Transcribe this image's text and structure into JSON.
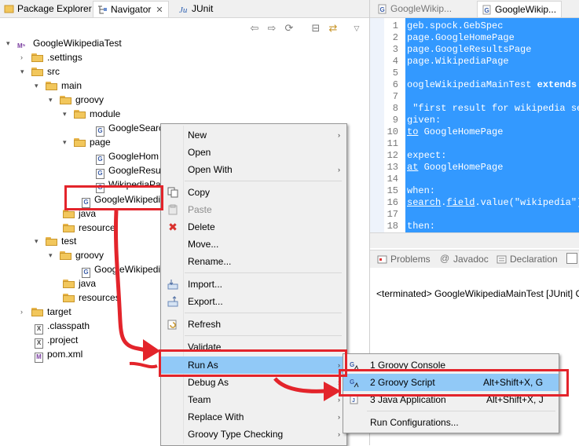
{
  "left_tabs": {
    "package_explorer": "Package Explorer",
    "navigator": "Navigator",
    "navigator_close": "✕",
    "junit": "JUnit"
  },
  "tree": {
    "project": "GoogleWikipediaTest",
    "settings": ".settings",
    "src": "src",
    "main": "main",
    "groovy": "groovy",
    "module": "module",
    "module_file": "GoogleSearc",
    "page": "page",
    "page_file_1": "GoogleHom",
    "page_file_2": "GoogleResu",
    "page_file_3": "WikipediaPa",
    "selected_file": "GoogleWikipedi",
    "java": "java",
    "resources": "resource",
    "test": "test",
    "test_groovy": "groovy",
    "test_file": "GoogleWikipedi",
    "test_java": "java",
    "test_resources": "resources",
    "target": "target",
    "classpath": ".classpath",
    "project_file": ".project",
    "pom": "pom.xml"
  },
  "editor_tabs": {
    "tab1": "GoogleWikip...",
    "tab2": "GoogleWikip..."
  },
  "code": {
    "l1": "geb.spock.GebSpec",
    "l2": "page.GoogleHomePage",
    "l3": "page.GoogleResultsPage",
    "l4": "page.WikipediaPage",
    "l6a": "oogleWikipediaMainTest ",
    "l6b": "extends",
    "l6c": " G",
    "l8": " \"first result for wikipedia sea",
    "l9": "given:",
    "l10a": "to",
    "l10b": " GoogleHomePage",
    "l12": "expect:",
    "l13a": "at",
    "l13b": " GoogleHomePage",
    "l15": "when:",
    "l16a": "search",
    "l16b": "field",
    "l16c": ".value(\"wikipedia\")",
    "l18": "then:"
  },
  "line_numbers": [
    "1",
    "2",
    "3",
    "4",
    "5",
    "6",
    "7",
    "8",
    "9",
    "10",
    "11",
    "12",
    "13",
    "14",
    "15",
    "16",
    "17",
    "18"
  ],
  "bottom_tabs": {
    "problems": "Problems",
    "javadoc": "Javadoc",
    "declaration": "Declaration"
  },
  "console": {
    "text": "<terminated> GoogleWikipediaMainTest [JUnit] C"
  },
  "context_menu": {
    "new": "New",
    "open": "Open",
    "open_with": "Open With",
    "copy": "Copy",
    "paste": "Paste",
    "delete": "Delete",
    "move": "Move...",
    "rename": "Rename...",
    "import": "Import...",
    "export": "Export...",
    "refresh": "Refresh",
    "validate": "Validate",
    "run_as": "Run As",
    "debug_as": "Debug As",
    "team": "Team",
    "replace_with": "Replace With",
    "groovy_type_checking": "Groovy Type Checking"
  },
  "submenu": {
    "groovy_console": "1 Groovy Console",
    "groovy_script": "2 Groovy Script",
    "groovy_script_shortcut": "Alt+Shift+X, G",
    "java_application": "3 Java Application",
    "java_application_shortcut": "Alt+Shift+X, J",
    "run_configurations": "Run Configurations..."
  },
  "colors": {
    "annotation_red": "#e3242b",
    "menu_highlight": "#91c9f7",
    "code_selection": "#3399ff"
  }
}
